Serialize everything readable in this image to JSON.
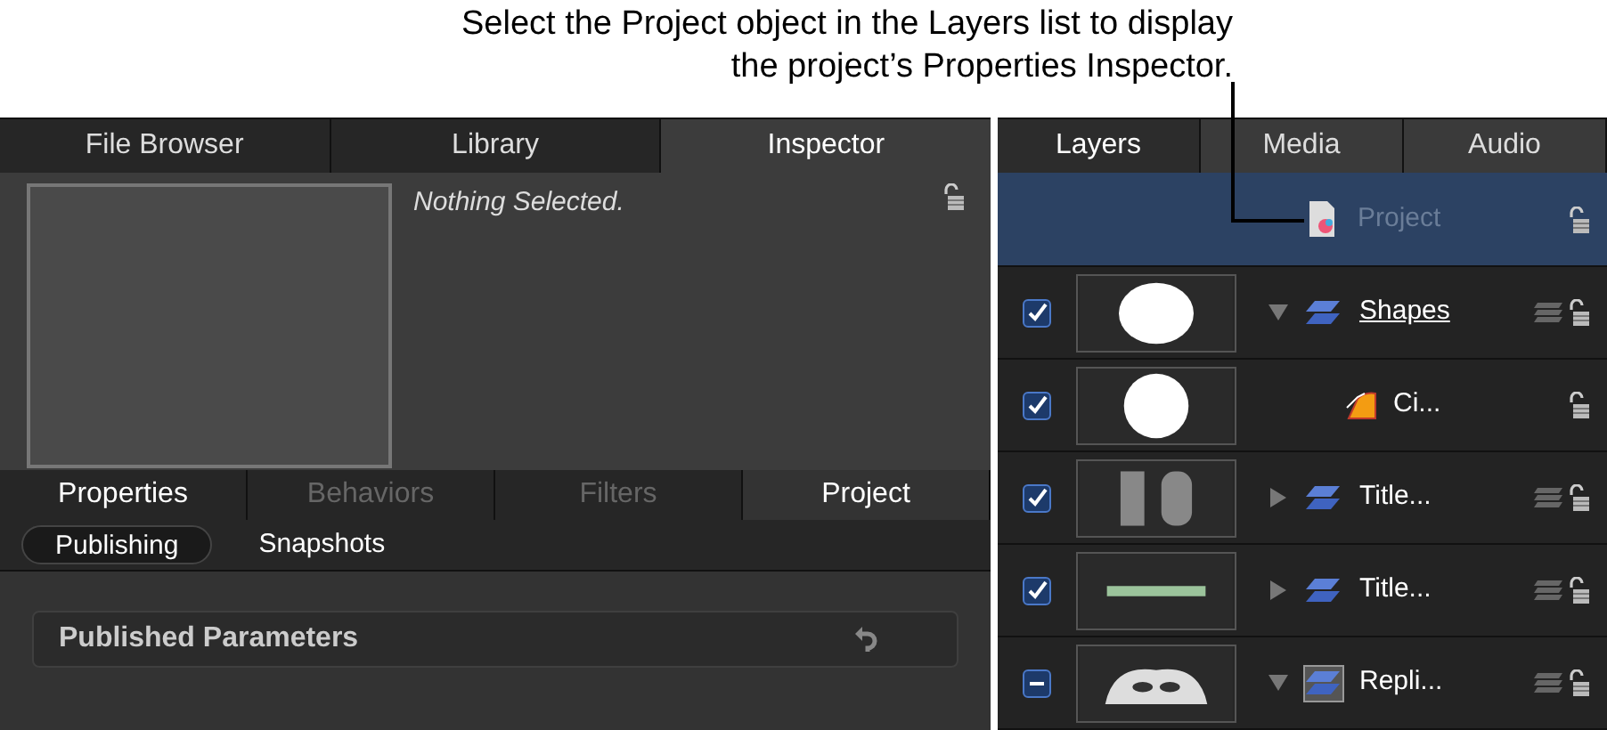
{
  "callout": "Select the Project object in the Layers list to display the project’s Properties Inspector.",
  "top_tabs": [
    {
      "label": "File Browser",
      "selected": false
    },
    {
      "label": "Library",
      "selected": false
    },
    {
      "label": "Inspector",
      "selected": true
    }
  ],
  "inspector": {
    "status": "Nothing Selected.",
    "locked": false
  },
  "inspector_tabs": [
    {
      "label": "Properties",
      "selected": false,
      "disabled": false
    },
    {
      "label": "Behaviors",
      "selected": false,
      "disabled": true
    },
    {
      "label": "Filters",
      "selected": false,
      "disabled": true
    },
    {
      "label": "Project",
      "selected": true,
      "disabled": false
    }
  ],
  "sub_tabs": [
    {
      "label": "Publishing",
      "selected": true
    },
    {
      "label": "Snapshots",
      "selected": false
    }
  ],
  "parameters_header": {
    "title": "Published Parameters"
  },
  "layer_tabs": [
    {
      "label": "Layers",
      "selected": true
    },
    {
      "label": "Media",
      "selected": false
    },
    {
      "label": "Audio",
      "selected": false
    }
  ],
  "project_row": {
    "name": "Project",
    "selected": true,
    "locked": false
  },
  "layers": [
    {
      "name": "Shapes",
      "kind": "group",
      "checked": true,
      "mixed": false,
      "expanded": true,
      "locked": false,
      "children": [
        {
          "name": "Ci...",
          "kind": "shape",
          "checked": true,
          "mixed": false,
          "locked": false
        }
      ]
    },
    {
      "name": "Title...",
      "kind": "group",
      "checked": true,
      "mixed": false,
      "expanded": false,
      "locked": false
    },
    {
      "name": "Title...",
      "kind": "group",
      "checked": true,
      "mixed": false,
      "expanded": false,
      "locked": false
    },
    {
      "name": "Repli...",
      "kind": "replicator",
      "checked": true,
      "mixed": true,
      "expanded": true,
      "locked": false
    }
  ]
}
